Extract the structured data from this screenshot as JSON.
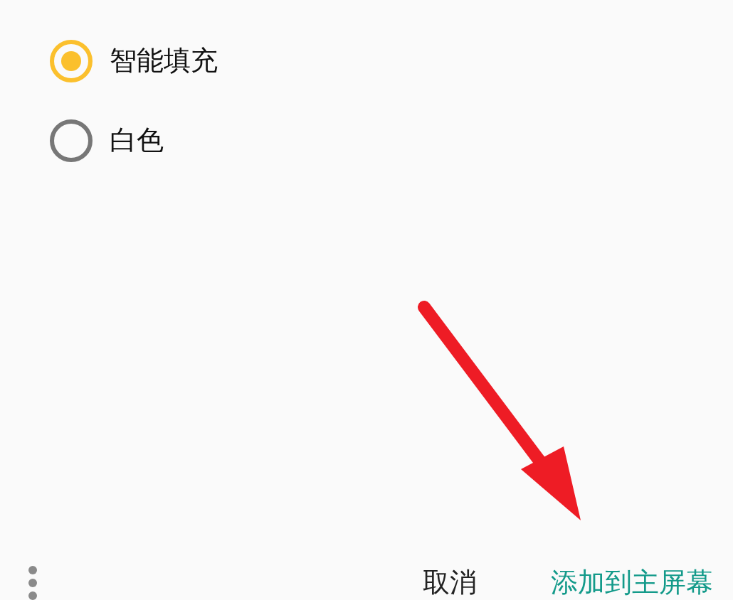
{
  "options": [
    {
      "label": "智能填充",
      "selected": true
    },
    {
      "label": "白色",
      "selected": false
    }
  ],
  "actions": [
    {
      "label": "取消",
      "kind": "neutral"
    },
    {
      "label": "添加到主屏幕",
      "kind": "primary"
    }
  ]
}
